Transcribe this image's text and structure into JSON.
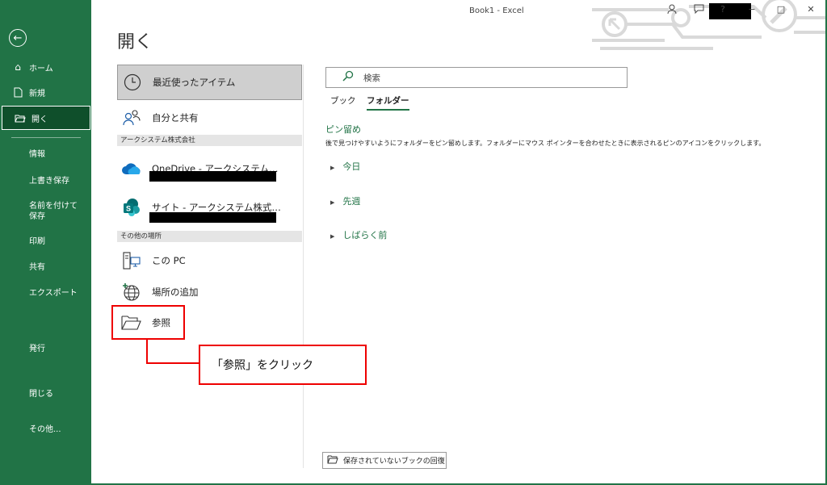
{
  "window": {
    "title": "Book1  -  Excel",
    "help": "?",
    "minimize": "−",
    "maximize": "□",
    "close": "✕"
  },
  "sidebar": {
    "back": "←",
    "items": [
      {
        "label": "ホーム",
        "icon": "home-icon"
      },
      {
        "label": "新規",
        "icon": "new-file-icon"
      },
      {
        "label": "開く",
        "icon": "open-folder-icon"
      }
    ],
    "text_items": [
      "情報",
      "上書き保存",
      "名前を付けて保存",
      "印刷",
      "共有",
      "エクスポート",
      "発行",
      "閉じる",
      "その他..."
    ]
  },
  "page": {
    "title": "開く"
  },
  "locations": {
    "recent": "最近使ったアイテム",
    "shared": "自分と共有",
    "group_org": "アークシステム株式会社",
    "onedrive": "OneDrive - アークシステム…",
    "sites": "サイト - アークシステム株式…",
    "group_other": "その他の場所",
    "this_pc": "この PC",
    "add_place": "場所の追加",
    "browse": "参照"
  },
  "callout": {
    "text": "「参照」をクリック"
  },
  "right_panel": {
    "search_placeholder": "検索",
    "tabs": [
      "ブック",
      "フォルダー"
    ],
    "active_tab": "フォルダー",
    "pin_title": "ピン留め",
    "pin_desc": "後で見つけやすいようにフォルダーをピン留めします。フォルダーにマウス ポインターを合わせたときに表示されるピンのアイコンをクリックします。",
    "groups": [
      "今日",
      "先週",
      "しばらく前"
    ],
    "recover_button": "保存されていないブックの回復"
  },
  "colors": {
    "accent": "#217346",
    "highlight": "#e00000"
  }
}
